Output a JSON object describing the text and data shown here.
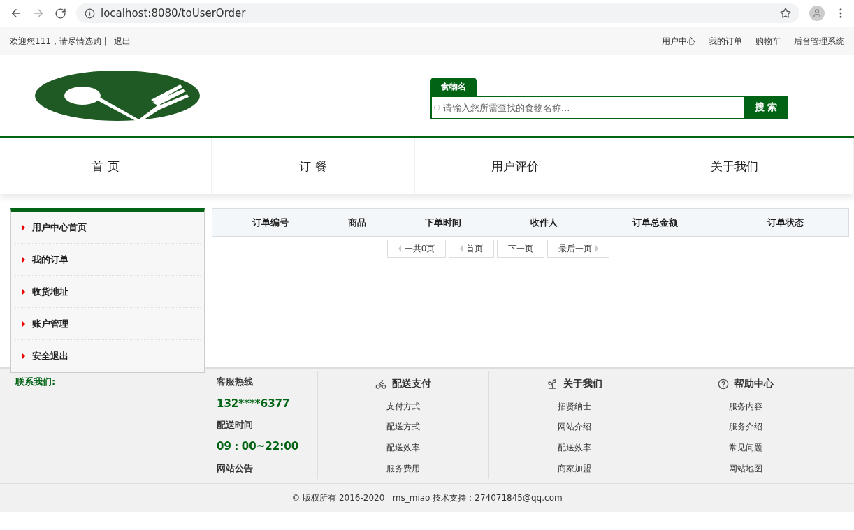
{
  "browser": {
    "url": "localhost:8080/toUserOrder"
  },
  "topbar": {
    "welcome": "欢迎您111，请尽情选购 |",
    "logout": "退出",
    "links": [
      "用户中心",
      "我的订单",
      "购物车",
      "后台管理系统"
    ]
  },
  "search": {
    "tab": "食物名",
    "placeholder": "请输入您所需查找的食物名称...",
    "button": "搜 索"
  },
  "nav": [
    "首 页",
    "订 餐",
    "用户评价",
    "关于我们"
  ],
  "sidebar": {
    "items": [
      "用户中心首页",
      "我的订单",
      "收货地址",
      "账户管理",
      "安全退出"
    ]
  },
  "table": {
    "columns": [
      "订单编号",
      "商品",
      "下单时间",
      "收件人",
      "订单总金额",
      "订单状态"
    ]
  },
  "pagination": [
    {
      "label": "一共0页",
      "kind": "left"
    },
    {
      "label": "首页",
      "kind": "left"
    },
    {
      "label": "下一页",
      "kind": "none"
    },
    {
      "label": "最后一页",
      "kind": "right"
    }
  ],
  "footer": {
    "contact_title": "联系我们:",
    "info": [
      {
        "label": "客服热线",
        "kind": "label"
      },
      {
        "label": "132****6377",
        "kind": "value"
      },
      {
        "label": "配送时间",
        "kind": "label"
      },
      {
        "label": "09：00~22:00",
        "kind": "value"
      },
      {
        "label": "网站公告",
        "kind": "label"
      }
    ],
    "columns": [
      {
        "title": "配送支付",
        "kind": "bike",
        "links": [
          "支付方式",
          "配送方式",
          "配送效率",
          "服务费用"
        ]
      },
      {
        "title": "关于我们",
        "kind": "leaf",
        "links": [
          "招贤纳士",
          "网站介绍",
          "配送效率",
          "商家加盟"
        ]
      },
      {
        "title": "帮助中心",
        "kind": "help",
        "links": [
          "服务内容",
          "服务介绍",
          "常见问题",
          "网站地图"
        ]
      }
    ],
    "copyright": "© 版权所有 2016-2020   ms_miao 技术支持：274071845@qq.com"
  }
}
